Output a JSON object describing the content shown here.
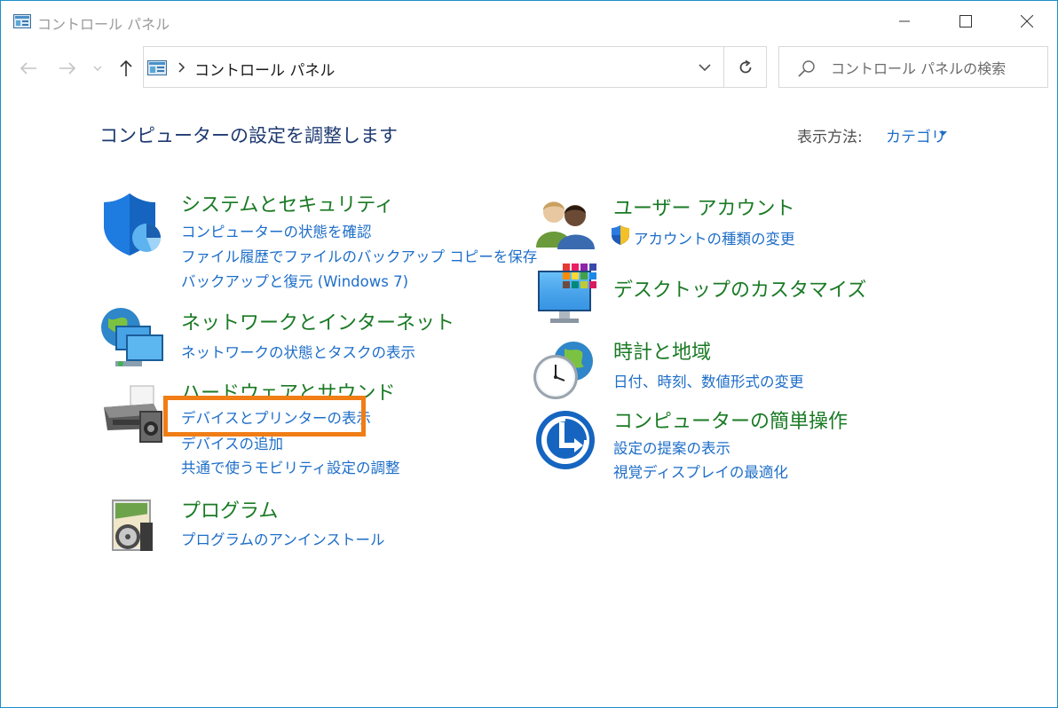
{
  "window": {
    "title": "コントロール パネル"
  },
  "nav": {
    "back_icon": "arrow-left-icon",
    "forward_icon": "arrow-right-icon",
    "up_icon": "arrow-up-icon"
  },
  "address": {
    "path": "コントロール パネル"
  },
  "search": {
    "placeholder": "コントロール パネルの検索"
  },
  "header": {
    "title": "コンピューターの設定を調整します",
    "view_label": "表示方法:",
    "view_value": "カテゴリ"
  },
  "categories": {
    "system": {
      "title": "システムとセキュリティ",
      "links": [
        "コンピューターの状態を確認",
        "ファイル履歴でファイルのバックアップ コピーを保存",
        "バックアップと復元 (Windows 7)"
      ]
    },
    "network": {
      "title": "ネットワークとインターネット",
      "links": [
        "ネットワークの状態とタスクの表示"
      ]
    },
    "hardware": {
      "title": "ハードウェアとサウンド",
      "links": [
        "デバイスとプリンターの表示",
        "デバイスの追加",
        "共通で使うモビリティ設定の調整"
      ]
    },
    "programs": {
      "title": "プログラム",
      "links": [
        "プログラムのアンインストール"
      ]
    },
    "users": {
      "title": "ユーザー アカウント",
      "links": [
        "アカウントの種類の変更"
      ]
    },
    "appearance": {
      "title": "デスクトップのカスタマイズ",
      "links": []
    },
    "clock": {
      "title": "時計と地域",
      "links": [
        "日付、時刻、数値形式の変更"
      ]
    },
    "ease": {
      "title": "コンピューターの簡単操作",
      "links": [
        "設定の提案の表示",
        "視覚ディスプレイの最適化"
      ]
    }
  },
  "colors": {
    "category_title": "#1a7a24",
    "link": "#1e6ec8",
    "highlight": "#f07d15",
    "window_border": "#1b8fc9"
  }
}
